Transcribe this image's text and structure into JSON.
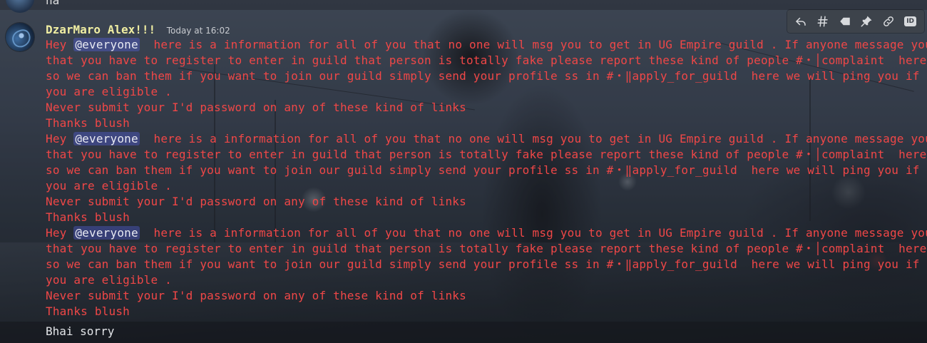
{
  "previous_message": {
    "text": "ha"
  },
  "message": {
    "author": "DzarMaro Alex!!!",
    "timestamp": "Today at 16:02",
    "mention": "@everyone",
    "lines": [
      [
        "Hey ",
        "@everyone",
        "  here is a information for all of you that no one will msg you to get in UG Empire guild . If anyone message you"
      ],
      [
        "that you have to register to enter in guild that person is totally fake please report these kind of people #・│complaint  here"
      ],
      [
        "so we can ban them if you want to join our guild simply send your profile ss in #・‖apply_for_guild  here we will ping you if"
      ],
      [
        "you are eligible ."
      ],
      [
        "Never submit your I'd password on any of these kind of links"
      ],
      [
        "Thanks blush"
      ],
      [
        "Hey ",
        "@everyone",
        "  here is a information for all of you that no one will msg you to get in UG Empire guild . If anyone message you"
      ],
      [
        "that you have to register to enter in guild that person is totally fake please report these kind of people #・│complaint  here"
      ],
      [
        "so we can ban them if you want to join our guild simply send your profile ss in #・‖apply_for_guild  here we will ping you if"
      ],
      [
        "you are eligible ."
      ],
      [
        "Never submit your I'd password on any of these kind of links"
      ],
      [
        "Thanks blush"
      ],
      [
        "Hey ",
        "@everyone",
        "  here is a information for all of you that no one will msg you to get in UG Empire guild . If anyone message you"
      ],
      [
        "that you have to register to enter in guild that person is totally fake please report these kind of people #・│complaint  here"
      ],
      [
        "so we can ban them if you want to join our guild simply send your profile ss in #・‖apply_for_guild  here we will ping you if"
      ],
      [
        "you are eligible ."
      ],
      [
        "Never submit your I'd password on any of these kind of links"
      ],
      [
        "Thanks blush"
      ]
    ]
  },
  "reply_message": {
    "text": "Bhai sorry"
  },
  "toolbar": {
    "buttons": [
      "reply-icon",
      "thread-icon",
      "tag-icon",
      "pin-icon",
      "link-icon",
      "id-icon"
    ],
    "id_label": "ID"
  },
  "colors": {
    "message_text": "#f04747",
    "username": "#f0eea2",
    "mention_bg": "#5865f2"
  }
}
